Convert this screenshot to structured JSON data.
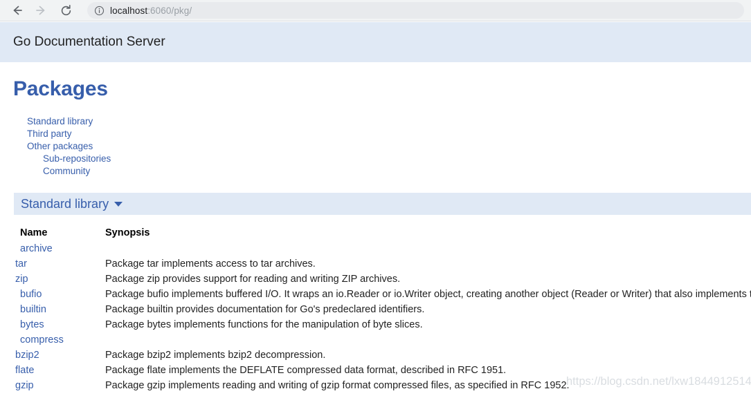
{
  "browser": {
    "back_icon": "arrow-left-icon",
    "forward_icon": "arrow-right-icon",
    "reload_icon": "reload-icon",
    "site_info_icon": "info-circle-icon",
    "url_host": "localhost",
    "url_path": ":6060/pkg/",
    "url_full": "localhost:6060/pkg/"
  },
  "header": {
    "title": "Go Documentation Server",
    "band_color": "#e0e9f5"
  },
  "page": {
    "title": "Packages",
    "title_color": "#375eab",
    "link_color": "#375eab"
  },
  "toc": [
    {
      "label": "Standard library",
      "level": 1
    },
    {
      "label": "Third party",
      "level": 1
    },
    {
      "label": "Other packages",
      "level": 1
    },
    {
      "label": "Sub-repositories",
      "level": 2
    },
    {
      "label": "Community",
      "level": 2
    }
  ],
  "stdlib_section": {
    "label": "Standard library",
    "caret_icon": "caret-down-icon"
  },
  "table": {
    "headers": {
      "name": "Name",
      "synopsis": "Synopsis"
    },
    "rows": [
      {
        "name": "archive",
        "indent": 0,
        "synopsis": ""
      },
      {
        "name": "tar",
        "indent": 1,
        "synopsis": "Package tar implements access to tar archives."
      },
      {
        "name": "zip",
        "indent": 1,
        "synopsis": "Package zip provides support for reading and writing ZIP archives."
      },
      {
        "name": "bufio",
        "indent": 0,
        "synopsis": "Package bufio implements buffered I/O. It wraps an io.Reader or io.Writer object, creating another object (Reader or Writer) that also implements the interface but provides buffering and some help for textual I/O."
      },
      {
        "name": "builtin",
        "indent": 0,
        "synopsis": "Package builtin provides documentation for Go's predeclared identifiers."
      },
      {
        "name": "bytes",
        "indent": 0,
        "synopsis": "Package bytes implements functions for the manipulation of byte slices."
      },
      {
        "name": "compress",
        "indent": 0,
        "synopsis": ""
      },
      {
        "name": "bzip2",
        "indent": 1,
        "synopsis": "Package bzip2 implements bzip2 decompression."
      },
      {
        "name": "flate",
        "indent": 1,
        "synopsis": "Package flate implements the DEFLATE compressed data format, described in RFC 1951."
      },
      {
        "name": "gzip",
        "indent": 1,
        "synopsis": "Package gzip implements reading and writing of gzip format compressed files, as specified in RFC 1952."
      }
    ]
  },
  "watermark": {
    "text": "https://blog.csdn.net/lxw1844912514"
  }
}
